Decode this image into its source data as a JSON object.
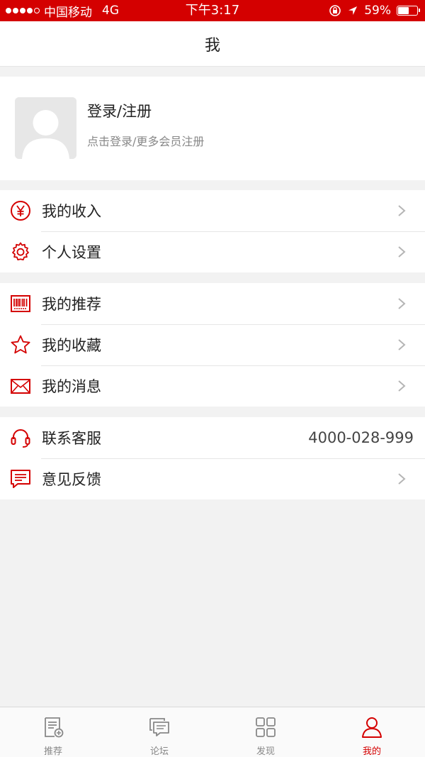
{
  "status_bar": {
    "carrier": "中国移动",
    "network": "4G",
    "time": "下午3:17",
    "battery_percent": "59%",
    "battery_level": 0.59
  },
  "nav": {
    "title": "我"
  },
  "profile": {
    "name": "登录/注册",
    "subtitle": "点击登录/更多会员注册"
  },
  "groups": [
    {
      "items": [
        {
          "label": "我的收入",
          "icon": "yen-icon"
        },
        {
          "label": "个人设置",
          "icon": "gear-icon"
        }
      ]
    },
    {
      "items": [
        {
          "label": "我的推荐",
          "icon": "barcode-icon"
        },
        {
          "label": "我的收藏",
          "icon": "star-icon"
        },
        {
          "label": "我的消息",
          "icon": "envelope-icon"
        }
      ]
    },
    {
      "items": [
        {
          "label": "联系客服",
          "icon": "headset-icon",
          "value": "4000-028-999"
        },
        {
          "label": "意见反馈",
          "icon": "feedback-icon"
        }
      ]
    }
  ],
  "tabs": [
    {
      "label": "推荐",
      "icon": "recommend-doc-icon",
      "active": false
    },
    {
      "label": "论坛",
      "icon": "forum-chat-icon",
      "active": false
    },
    {
      "label": "发现",
      "icon": "discover-grid-icon",
      "active": false
    },
    {
      "label": "我的",
      "icon": "person-icon",
      "active": true
    }
  ],
  "colors": {
    "accent": "#d40000",
    "background": "#f2f2f2",
    "text": "#222222",
    "secondary_text": "#888888"
  }
}
